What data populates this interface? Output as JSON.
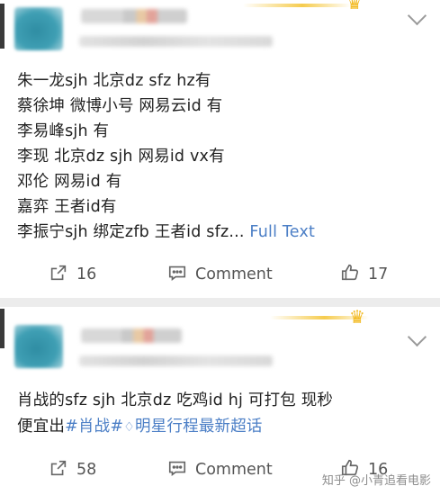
{
  "posts": [
    {
      "lines": [
        "朱一龙sjh 北京dz sfz hz有",
        "蔡徐坤 微博小号 网易云id 有",
        "李易峰sjh 有",
        "李现 北京dz sjh 网易id vx有",
        "邓伦 网易id 有",
        "嘉弈 王者id有",
        "李振宁sjh 绑定zfb 王者id sfz..."
      ],
      "full_text_link": "Full Text",
      "share_count": "16",
      "comment_label": "Comment",
      "like_count": "17"
    },
    {
      "line1": "肖战的sfz sjh 北京dz 吃鸡id hj 可打包 现秒",
      "line2_prefix": "便宜出",
      "hashtag1": "#肖战#",
      "hashtag2": "明星行程最新超话",
      "share_count": "58",
      "comment_label": "Comment",
      "like_count": "16"
    }
  ],
  "watermark": "知乎 @小青追看电影",
  "colors": {
    "link": "#4c7fc6",
    "action_text": "#555555",
    "crown": "#f2b81c"
  },
  "icons": [
    "share-icon",
    "comment-icon",
    "like-icon",
    "chevron-down-icon",
    "crown-icon"
  ]
}
